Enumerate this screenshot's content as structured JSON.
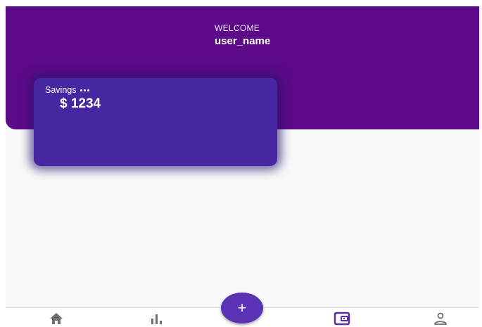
{
  "header": {
    "greeting": "WELCOME",
    "user_name": "user_name"
  },
  "account_card": {
    "title": "Savings",
    "amount": "$ 1234",
    "menu_icon": "more-horizontal-icon"
  },
  "fab": {
    "label": "+",
    "icon": "add-icon"
  },
  "bottom_nav": {
    "items": [
      {
        "icon": "home-icon",
        "active": false
      },
      {
        "icon": "bar-chart-icon",
        "active": false
      },
      {
        "icon": "wallet-icon",
        "active": true
      },
      {
        "icon": "profile-icon",
        "active": false
      }
    ]
  },
  "colors": {
    "header": "#5c0a87",
    "card": "#4727a1",
    "fab": "#5b34b5",
    "nav_active": "#5a2ca0",
    "nav_inactive": "#6f6f6f",
    "background": "#f9f9f9"
  }
}
